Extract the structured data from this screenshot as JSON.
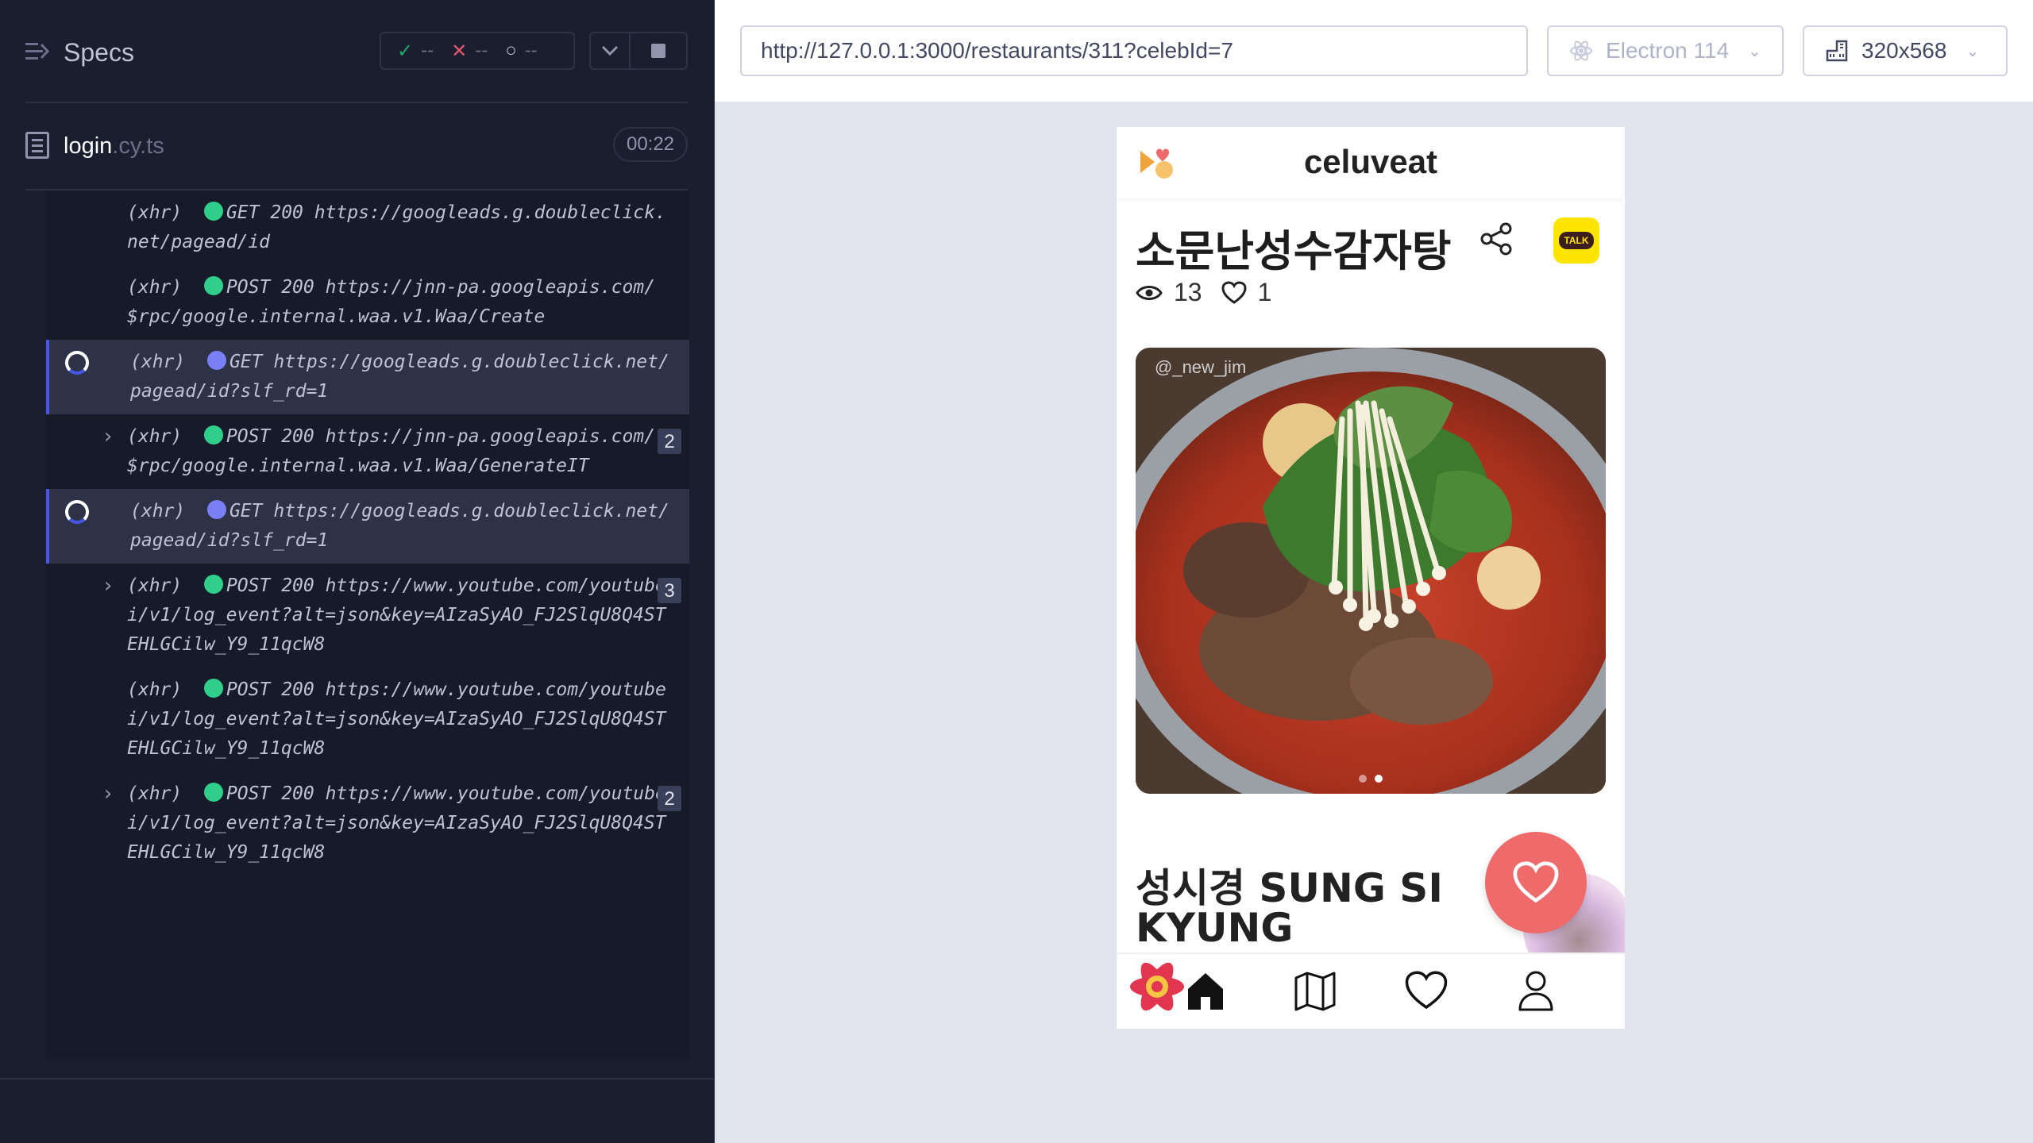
{
  "sidebar": {
    "title": "Specs",
    "stats": {
      "passed": "--",
      "failed": "--",
      "pending": "--"
    },
    "file": {
      "name": "login",
      "ext": ".cy.ts",
      "duration": "00:22"
    }
  },
  "log": [
    {
      "kind": "(xhr)",
      "text": "GET 200 https://googleads.g.doubleclick.net/pagead/id",
      "status": "ok",
      "active": false,
      "expandable": false,
      "count": ""
    },
    {
      "kind": "(xhr)",
      "text": "POST 200 https://jnn-pa.googleapis.com/$rpc/google.internal.waa.v1.Waa/Create",
      "status": "ok",
      "active": false,
      "expandable": false,
      "count": ""
    },
    {
      "kind": "(xhr)",
      "text": "GET https://googleads.g.doubleclick.net/pagead/id?slf_rd=1",
      "status": "pending",
      "active": true,
      "expandable": false,
      "count": ""
    },
    {
      "kind": "(xhr)",
      "text": "POST 200 https://jnn-pa.googleapis.com/$rpc/google.internal.waa.v1.Waa/GenerateIT",
      "status": "ok",
      "active": false,
      "expandable": true,
      "count": "2"
    },
    {
      "kind": "(xhr)",
      "text": "GET https://googleads.g.doubleclick.net/pagead/id?slf_rd=1",
      "status": "pending",
      "active": true,
      "expandable": false,
      "count": ""
    },
    {
      "kind": "(xhr)",
      "text": "POST 200 https://www.youtube.com/youtubei/v1/log_event?alt=json&key=AIzaSyAO_FJ2SlqU8Q4STEHLGCilw_Y9_11qcW8",
      "status": "ok",
      "active": false,
      "expandable": true,
      "count": "3"
    },
    {
      "kind": "(xhr)",
      "text": "POST 200 https://www.youtube.com/youtubei/v1/log_event?alt=json&key=AIzaSyAO_FJ2SlqU8Q4STEHLGCilw_Y9_11qcW8",
      "status": "ok",
      "active": false,
      "expandable": false,
      "count": ""
    },
    {
      "kind": "(xhr)",
      "text": "POST 200 https://www.youtube.com/youtubei/v1/log_event?alt=json&key=AIzaSyAO_FJ2SlqU8Q4STEHLGCilw_Y9_11qcW8",
      "status": "ok",
      "active": false,
      "expandable": true,
      "count": "2"
    }
  ],
  "toolbar": {
    "url": "http://127.0.0.1:3000/restaurants/311?celebId=7",
    "browser": "Electron 114",
    "viewport": "320x568"
  },
  "app": {
    "brand": "celuveat",
    "restaurant_name": "소문난성수감자탕",
    "views": "13",
    "likes": "1",
    "photo_credit": "@_new_jim",
    "celeb_name": "성시경 SUNG SI KYUNG",
    "kakao_label": "TALK",
    "colors": {
      "like_fab": "#ef6b6b",
      "kakao": "#fee500",
      "status_ok": "#2fcf8b",
      "status_pending": "#7a7ff5"
    }
  }
}
